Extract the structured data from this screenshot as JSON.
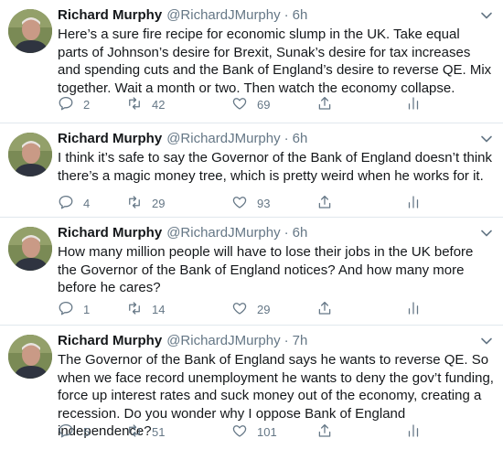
{
  "tweets": [
    {
      "name": "Richard Murphy",
      "handle": "@RichardJMurphy",
      "separator": "·",
      "time": "6h",
      "text": "Here’s a sure fire recipe for economic slump in the UK. Take equal parts of Johnson’s desire for Brexit, Sunak’s desire for tax increases and spending cuts and the Bank of England’s desire to reverse QE. Mix together. Wait a month or two. Then watch the economy collapse.",
      "replies": "2",
      "retweets": "42",
      "likes": "69"
    },
    {
      "name": "Richard Murphy",
      "handle": "@RichardJMurphy",
      "separator": "·",
      "time": "6h",
      "text": "I think it’s safe to say the Governor of the Bank of England doesn’t think there’s a magic money tree, which is pretty weird when he works for it.",
      "replies": "4",
      "retweets": "29",
      "likes": "93"
    },
    {
      "name": "Richard Murphy",
      "handle": "@RichardJMurphy",
      "separator": "·",
      "time": "6h",
      "text": "How many million people will have to lose their jobs in the UK before the Governor of the Bank of England notices? And how many more before he cares?",
      "replies": "1",
      "retweets": "14",
      "likes": "29"
    },
    {
      "name": "Richard Murphy",
      "handle": "@RichardJMurphy",
      "separator": "·",
      "time": "7h",
      "text": "The Governor of the Bank of England says he wants to reverse QE. So when we face record unemployment he wants to deny the gov’t funding, force up interest rates and suck money out of the economy, creating a recession. Do you wonder why I oppose Bank of England  independence?",
      "replies": "5",
      "retweets": "51",
      "likes": "101"
    }
  ],
  "colors": {
    "text": "#14171a",
    "muted": "#657786",
    "divider": "#e1e8ed"
  },
  "icons": [
    "avatar",
    "caret-down-icon",
    "reply-icon",
    "retweet-icon",
    "like-icon",
    "share-icon",
    "analytics-icon"
  ]
}
